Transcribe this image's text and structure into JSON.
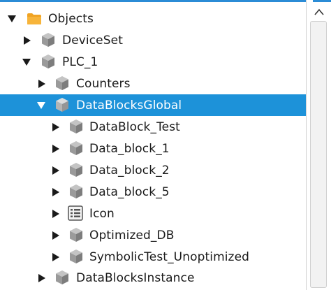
{
  "tree": {
    "items": [
      {
        "label": "Objects",
        "icon": "folder-icon",
        "toggle": "expanded"
      },
      {
        "label": "DeviceSet",
        "icon": "cube-icon",
        "toggle": "collapsed"
      },
      {
        "label": "PLC_1",
        "icon": "cube-icon",
        "toggle": "expanded"
      },
      {
        "label": "Counters",
        "icon": "cube-icon",
        "toggle": "collapsed"
      },
      {
        "label": "DataBlocksGlobal",
        "icon": "cube-icon",
        "toggle": "expanded",
        "selected": true
      },
      {
        "label": "DataBlock_Test",
        "icon": "cube-icon",
        "toggle": "collapsed"
      },
      {
        "label": "Data_block_1",
        "icon": "cube-icon",
        "toggle": "collapsed"
      },
      {
        "label": "Data_block_2",
        "icon": "cube-icon",
        "toggle": "collapsed"
      },
      {
        "label": "Data_block_5",
        "icon": "cube-icon",
        "toggle": "collapsed"
      },
      {
        "label": "Icon",
        "icon": "list-icon",
        "toggle": "collapsed"
      },
      {
        "label": "Optimized_DB",
        "icon": "cube-icon",
        "toggle": "collapsed"
      },
      {
        "label": "SymbolicTest_Unoptimized",
        "icon": "cube-icon",
        "toggle": "collapsed"
      },
      {
        "label": "DataBlocksInstance",
        "icon": "cube-icon",
        "toggle": "collapsed"
      }
    ]
  },
  "colors": {
    "selection": "#1d92d9",
    "accent_border": "#2b8cd6",
    "folder": "#f0a323",
    "cube": "#9a9a9a"
  },
  "scrollbar": {
    "up_icon": "chevron-up-icon"
  }
}
